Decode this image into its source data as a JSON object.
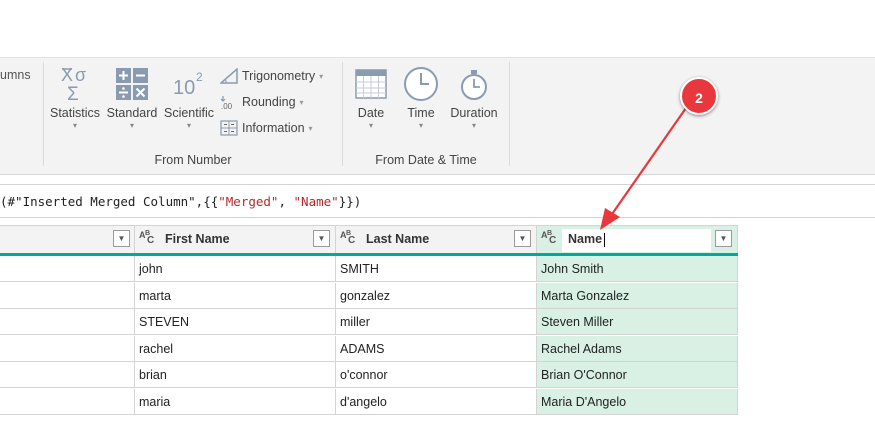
{
  "ribbon": {
    "cut_label": "umns",
    "buttons": {
      "statistics": "Statistics",
      "standard": "Standard",
      "scientific": "Scientific",
      "trigonometry": "Trigonometry",
      "rounding": "Rounding",
      "information": "Information",
      "date": "Date",
      "time": "Time",
      "duration": "Duration"
    },
    "scientific_icon_text": "10",
    "scientific_icon_sup": "2",
    "rounding_icon_text": ".00",
    "groups": {
      "from_number": "From Number",
      "from_date_time": "From Date & Time"
    }
  },
  "formula_bar": {
    "prefix": "(#\"Inserted Merged Column\",{{",
    "str1": "\"Merged\"",
    "sep": ", ",
    "str2": "\"Name\"",
    "suffix": "}})"
  },
  "table": {
    "columns": [
      "",
      "First Name",
      "Last Name",
      "Name"
    ],
    "type_icon": "ABC",
    "rows": [
      [
        "",
        "john",
        "SMITH",
        "John Smith"
      ],
      [
        "",
        "marta",
        "gonzalez",
        "Marta Gonzalez"
      ],
      [
        "",
        "STEVEN",
        "miller",
        "Steven Miller"
      ],
      [
        "",
        "rachel",
        "ADAMS",
        "Rachel Adams"
      ],
      [
        "",
        "brian",
        "o'connor",
        "Brian O'Connor"
      ],
      [
        "",
        "maria",
        "d'angelo",
        "Maria D'Angelo"
      ]
    ]
  },
  "annotation": {
    "step": "2"
  },
  "colors": {
    "accent_teal": "#00a99d",
    "annotation_red": "#e8383d",
    "selected_col": "#d9f0e5"
  }
}
